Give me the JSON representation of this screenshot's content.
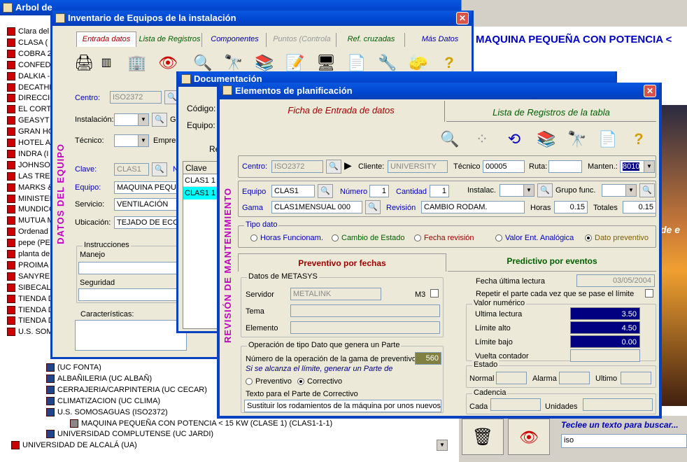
{
  "tree": {
    "title": "Arbol de",
    "items": [
      "Clara del",
      "CLASA (",
      "COBRA 2",
      "CONFED",
      "DALKIA -",
      "DECATHL",
      "DIRECCIO",
      "EL CORT",
      "GEASYT",
      "GRAN HO",
      "HOTEL A",
      "INDRA (I",
      "JOHNSO",
      "LAS TRE",
      "MARKS &",
      "MINISTEI",
      "MUNDICO",
      "MUTUA M",
      "Ordenad",
      "pepe (PE",
      "planta de",
      "PROIMA",
      "SANYRE",
      "SIBECAL",
      "TIENDA D",
      "TIENDA D",
      "TIENDA D",
      "U.S. SOM"
    ],
    "sub_items": [
      "(UC FONTA)",
      "ALBAÑILERIA (UC ALBAÑ)",
      "CERRAJERIA/CARPINTERIA (UC CECAR)",
      "CLIMATIZACION (UC CLIMA)",
      "U.S. SOMOSAGUAS (ISO2372)",
      "MAQUINA PEQUEÑA CON POTENCIA < 15 KW (CLASE 1) (CLAS1-1-1)",
      "UNIVERSIDAD COMPLUTENSE (UC JARDI)",
      "UNIVERSIDAD DE ALCALÁ (UA)"
    ]
  },
  "right": {
    "headline": "MAQUINA PEQUEÑA CON POTENCIA <",
    "photo_text": "de e",
    "search_prompt": "Teclee un texto para buscar...",
    "search_value": "iso"
  },
  "inventario": {
    "title": "Inventario de Equipos de la instalación",
    "tabs": [
      "Entrada datos",
      "Lista de Registros",
      "Componentes",
      "Puntos (Controla",
      "Ref. cruzadas",
      "Más Datos"
    ],
    "vertical": "DATOS DEL EQUIPO",
    "centro_label": "Centro:",
    "centro": "ISO2372",
    "instalacion_label": "Instalación:",
    "g_label": "G",
    "tecnico_label": "Técnico:",
    "empresa_label": "Empres",
    "clave_label": "Clave:",
    "clave": "CLAS1",
    "n_label": "N",
    "equipo_label": "Equipo:",
    "equipo": "MAQUINA PEQUEÑ",
    "servicio_label": "Servicio:",
    "servicio": "VENTILACIÓN",
    "ubicacion_label": "Ubicación:",
    "ubicacion": "TEJADO DE ECONO",
    "instrucciones": "Instrucciones",
    "manejo": "Manejo",
    "seguridad": "Seguridad",
    "caracteristicas": "Características:"
  },
  "documentos": {
    "title": "Documentación",
    "codigo_label": "Código:",
    "equipo_label": "Equipo:",
    "re_label": "Re",
    "col_clave": "Clave",
    "rows": [
      [
        "CLAS1",
        "1"
      ],
      [
        "CLAS1",
        "1"
      ]
    ]
  },
  "planif": {
    "title": "Elementos de planificación",
    "tab_ficha": "Ficha de Entrada de datos",
    "tab_lista": "Lista de Registros de la tabla",
    "vertical": "REVISIÓN DE MANTENIMIENTO",
    "centro_label": "Centro:",
    "centro": "ISO2372",
    "cliente_label": "Cliente:",
    "cliente": "UNIVERSITY",
    "tecnico_label": "Técnico",
    "tecnico": "00005",
    "ruta_label": "Ruta:",
    "ruta": "",
    "manten_label": "Manten.:",
    "manten": "8010",
    "equipo_label": "Equipo",
    "equipo": "CLAS1",
    "numero_label": "Número",
    "numero": "1",
    "cantidad_label": "Cantidad",
    "cantidad": "1",
    "instalac_label": "Instalac.",
    "grupo_label": "Grupo func.",
    "gama_label": "Gama",
    "gama": "CLAS1MENSUAL  000",
    "revision_label": "Revisión",
    "revision": "CAMBIO RODAM.",
    "horas_label": "Horas",
    "horas": "0.15",
    "totales_label": "Totales",
    "totales": "0.15",
    "tipo_label": "Tipo dato",
    "tipos": [
      "Horas Funcionam.",
      "Cambio de Estado",
      "Fecha revisión",
      "Valor Ent. Analógica",
      "Dato preventivo"
    ],
    "prev_tab": "Preventivo por fechas",
    "pred_tab": "Predictivo por eventos",
    "metasys_label": "Datos de METASYS",
    "servidor_label": "Servidor",
    "servidor": "METALINK",
    "m3_label": "M3",
    "tema_label": "Tema",
    "elemento_label": "Elemento",
    "op_label": "Operación de tipo Dato que genera un Parte",
    "op_num_label": "Número de la operación de la gama de preventivo",
    "op_num": "560",
    "op_hint": "Si se alcanza el límite, generar un Parte de",
    "preventivo": "Preventivo",
    "correctivo": "Correctivo",
    "texto_label": "Texto para el Parte de Correctivo",
    "texto": "Sustituir los rodamientos de la máquina por unos nuevos SKF",
    "fecha_label": "Fecha última lectura",
    "fecha": "03/05/2004",
    "repetir_label": "Repetir el parte cada vez que se pase el límite",
    "valor_label": "Valor numérico",
    "ultima_label": "Ultima lectura",
    "ultima": "3.50",
    "alto_label": "Límite alto",
    "alto": "4.50",
    "bajo_label": "Límite bajo",
    "bajo": "0.00",
    "vuelta_label": "Vuelta contador",
    "estado_label": "Estado",
    "normal_label": "Normal",
    "alarma_label": "Alarma",
    "ultimo_label": "Ultimo",
    "cadencia_label": "Cadencia",
    "cada_label": "Cada",
    "unidades_label": "Unidades"
  }
}
